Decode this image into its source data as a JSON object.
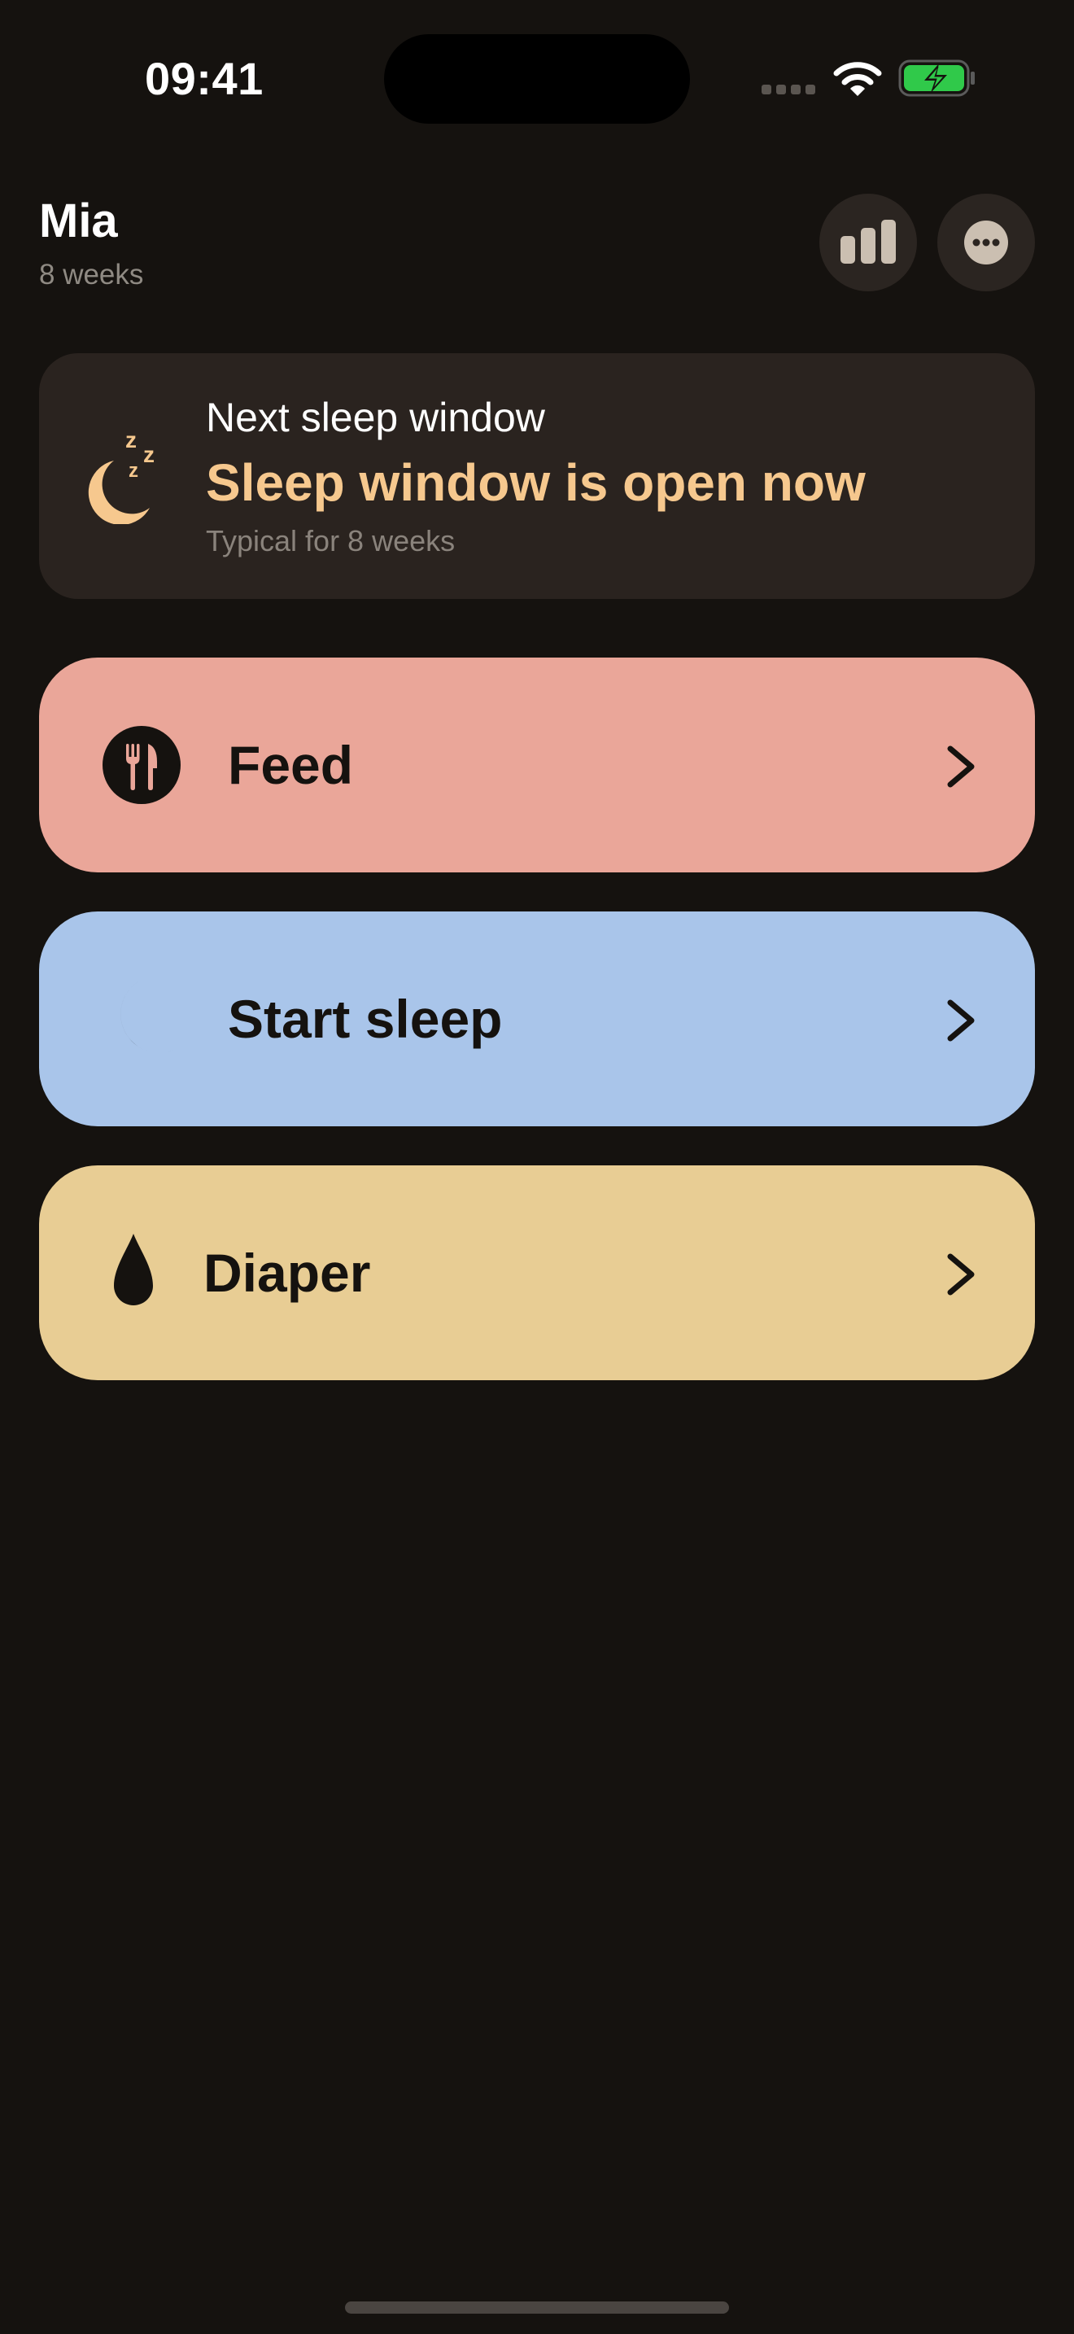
{
  "status_bar": {
    "time": "09:41",
    "signal_icon": "signal-icon",
    "wifi_icon": "wifi-icon",
    "battery_icon": "battery-charging-icon",
    "battery_color": "#30c94a"
  },
  "header": {
    "name": "Mia",
    "age": "8 weeks",
    "stats_icon": "bar-chart-icon",
    "more_icon": "more-icon"
  },
  "sleep_window": {
    "icon": "moon-zzz-icon",
    "title": "Next sleep window",
    "status": "Sleep window is open now",
    "subtitle": "Typical for 8 weeks",
    "accent_color": "#f6c88e"
  },
  "actions": [
    {
      "label": "Feed",
      "icon": "fork-knife-icon",
      "color": "#eaa699"
    },
    {
      "label": "Start sleep",
      "icon": "moon-icon",
      "color": "#a9c5ea"
    },
    {
      "label": "Diaper",
      "icon": "drop-icon",
      "color": "#e8cd94"
    }
  ]
}
